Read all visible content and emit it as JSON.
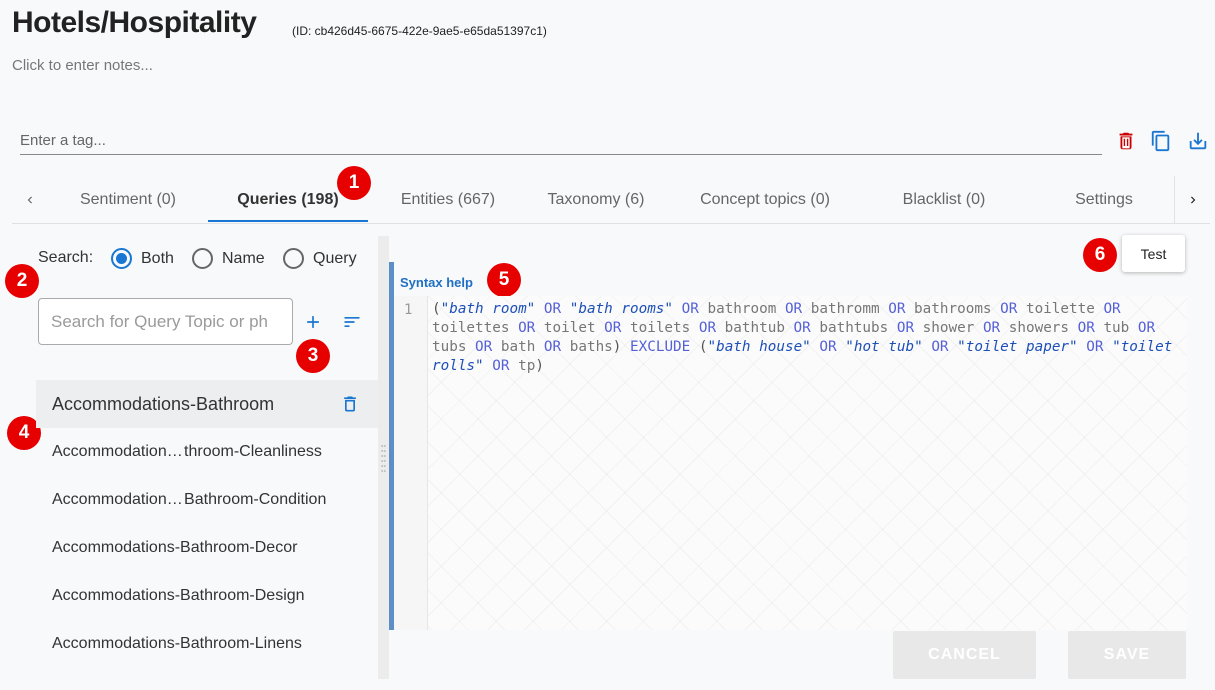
{
  "header": {
    "title": "Hotels/Hospitality",
    "id_label": "(ID: cb426d45-6675-422e-9ae5-e65da51397c1)",
    "notes_placeholder": "Click to enter notes...",
    "tag_placeholder": "Enter a tag...",
    "icons": [
      "trash-icon",
      "copy-icon",
      "download-icon"
    ],
    "colors": {
      "trash": "#cc0000",
      "accent": "#1976d2"
    }
  },
  "tabs": [
    {
      "label": "Sentiment (0)",
      "active": false
    },
    {
      "label": "Queries (198)",
      "active": true
    },
    {
      "label": "Entities (667)",
      "active": false
    },
    {
      "label": "Taxonomy (6)",
      "active": false
    },
    {
      "label": "Concept topics (0)",
      "active": false
    },
    {
      "label": "Blacklist (0)",
      "active": false
    },
    {
      "label": "Settings",
      "active": false
    }
  ],
  "markers": [
    "1",
    "2",
    "3",
    "4",
    "5",
    "6"
  ],
  "search": {
    "label": "Search:",
    "options": [
      "Both",
      "Name",
      "Query"
    ],
    "selected": "Both",
    "placeholder": "Search for Query Topic or ph"
  },
  "list": {
    "items": [
      "Accommodations-Bathroom",
      "Accommodation… throom-Cleanliness",
      "Accommodation… Bathroom-Condition",
      "Accommodations-Bathroom-Decor",
      "Accommodations-Bathroom-Design",
      "Accommodations-Bathroom-Linens"
    ]
  },
  "editor": {
    "syntax_help": "Syntax help",
    "line_number": "1",
    "query_text": "(\"bath room\" OR \"bath rooms\" OR bathroom OR bathromm OR bathrooms OR toilette OR toilettes OR toilet OR toilets OR bathtub OR bathtubs OR shower OR showers OR tub OR tubs OR bath OR baths) EXCLUDE (\"bath house\" OR \"hot tub\" OR \"toilet paper\" OR \"toilet rolls\" OR tp)"
  },
  "actions": {
    "test": "Test",
    "cancel": "CANCEL",
    "save": "SAVE"
  }
}
